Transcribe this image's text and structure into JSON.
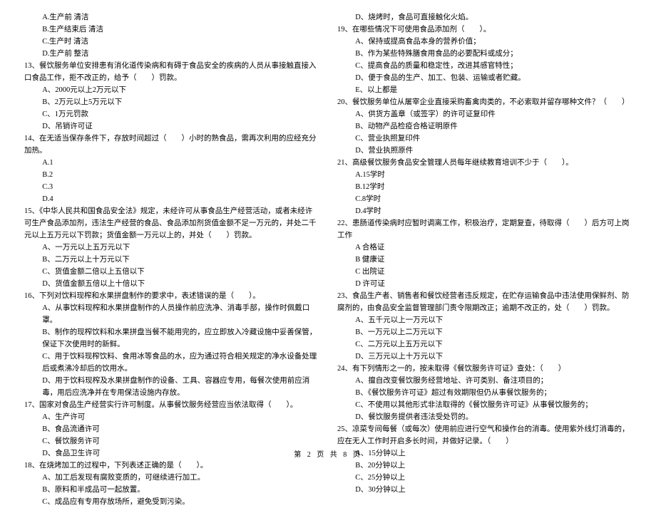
{
  "left": {
    "pre_opts": [
      "A.生产前 清洁",
      "B.生产结束后 清洁",
      "C.生产时 清洁",
      "D.生产前 整洁"
    ],
    "q13": "13、餐饮服务单位安排患有消化道传染病和有碍于食品安全的疾病的人员从事接触直接入口食品工作，拒不改正的，给予（　　）罚款。",
    "q13_opts": [
      "A、2000元以上2万元以下",
      "B、2万元以上5万元以下",
      "C、1万元罚款",
      "D、吊销许可证"
    ],
    "q14": "14、在无适当保存条件下，存放时间超过（　　）小时的熟食品，需再次利用的应经充分加热。",
    "q14_opts": [
      "A.1",
      "B.2",
      "C.3",
      "D.4"
    ],
    "q15": "15、《中华人民共和国食品安全法》规定，未经许可从事食品生产经营活动，或者未经许可生产食品添加剂，违法生产经营的食品、食品添加剂货值金额不足一万元的，并处二千元以上五万元以下罚款；货值金额一万元以上的，并处（　　）罚款。",
    "q15_opts": [
      "A、一万元以上五万元以下",
      "B、二万元以上十万元以下",
      "C、货值金额二倍以上五倍以下",
      "D、货值金额五倍以上十倍以下"
    ],
    "q16": "16、下列对饮料现榨和水果拼盘制作的要求中，表述错误的是（　　）。",
    "q16_opts": [
      "A、从事饮料现榨和水果拼盘制作的人员操作前应洗净、消毒手部，操作时佩戴口罩。",
      "B、制作的现榨饮料和水果拼盘当餐不能用完的，应立即放入冷藏设施中妥善保管，保证下次使用时的新鲜。",
      "C、用于饮料现榨饮料、食用冰等食品的水，应为通过符合相关规定的净水设备处理后或煮沸冷却后的饮用水。",
      "D、用于饮料现榨及水果拼盘制作的设备、工具、容器应专用，每餐次使用前应消毒，用后应洗净并在专用保洁设施内存放。"
    ],
    "q17": "17、国家对食品生产经营实行许可制度。从事餐饮服务经营应当依法取得（　　）。",
    "q17_opts": [
      "A、生产许可",
      "B、食品流通许可",
      "C、餐饮服务许可",
      "D、食品卫生许可"
    ],
    "q18": "18、在烧烤加工的过程中，下列表述正确的是（　　）。",
    "q18_opts": [
      "A、加工后发现有腐败变质的，可继续进行加工。",
      "B、原料和半成品可一起放置。",
      "C、成品应有专用存放场所，避免受到污染。"
    ]
  },
  "right": {
    "pre_opt": "D、烧烤时，食品可直接触化火焰。",
    "q19": "19、在哪些情况下可使用食品添加剂（　　）。",
    "q19_opts": [
      "A、保持或提高食品本身的营养价值；",
      "B、作为某些特殊膳食用食品的必要配料或成分；",
      "C、提高食品的质量和稳定性，改进其感官特性；",
      "D、便于食品的生产、加工、包装、运输或者贮藏。",
      "E、以上都是"
    ],
    "q20": "20、餐饮服务单位从屠宰企业直接采购畜禽肉类的，不必索取并留存哪种文件？（　　）",
    "q20_opts": [
      "A、供货方盖章（或签字）的许可证复印件",
      "B、动物产品检疫合格证明原件",
      "C、营业执照复印件",
      "D、营业执照原件"
    ],
    "q21": "21、高级餐饮服务食品安全管理人员每年继续教育培训不少于（　　）。",
    "q21_opts": [
      "A.15学时",
      "B.12学时",
      "C.8学时",
      "D.4学时"
    ],
    "q22": "22、患肠道传染病时应暂时调离工作，积极治疗，定期复查，待取得（　　）后方可上岗工作",
    "q22_opts": [
      "A 合格证",
      "B 健康证",
      "C 出院证",
      "D 许可证"
    ],
    "q23": "23、食品生产者、销售者和餐饮经营者违反规定，在贮存运输食品中违法使用保鲜剂、防腐剂的，由食品安全监督管理部门责令限期改正；逾期不改正的，处（　　）罚款。",
    "q23_opts": [
      "A、五千元以上一万元以下",
      "B、一万元以上二万元以下",
      "C、二万元以上五万元以下",
      "D、三万元以上十万元以下"
    ],
    "q24": "24、有下列情形之一的，按未取得《餐饮服务许可证》查处：（　　）",
    "q24_opts": [
      "A、擅自改变餐饮服务经营地址、许可类别、备注项目的；",
      "B、《餐饮服务许可证》超过有效期限但仍从事餐饮服务的；",
      "C、不使用以其他形式非法取得的《餐饮服务许可证》从事餐饮服务的；",
      "D、餐饮服务提供者违法受处罚的。"
    ],
    "q25": "25、凉菜专间每餐（或每次）使用前应进行空气和操作台的消毒。使用紫外线灯消毒的，应在无人工作时开启多长时间，并做好记录。（　　）",
    "q25_opts": [
      "A、15分钟以上",
      "B、20分钟以上",
      "C、25分钟以上",
      "D、30分钟以上"
    ]
  },
  "footer": "第 2 页 共 8 页"
}
